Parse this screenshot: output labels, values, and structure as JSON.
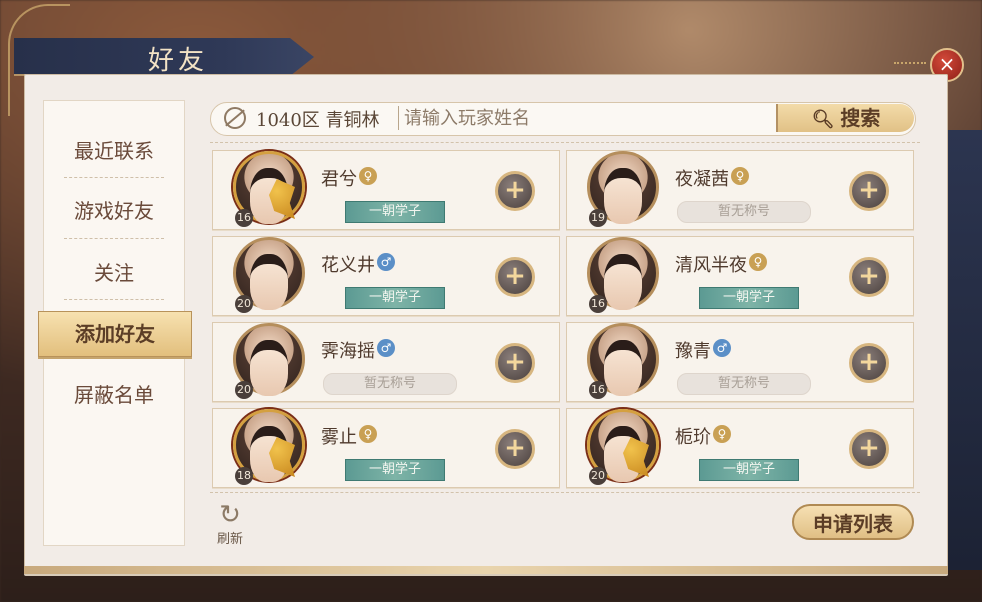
{
  "header": {
    "title": "好友",
    "close_icon": "×"
  },
  "nav": {
    "items": [
      {
        "label": "最近联系",
        "active": false
      },
      {
        "label": "游戏好友",
        "active": false
      },
      {
        "label": "关注",
        "active": false
      },
      {
        "label": "添加好友",
        "active": true
      },
      {
        "label": "屏蔽名单",
        "active": false
      }
    ]
  },
  "search": {
    "server": "1040区 青铜林",
    "placeholder": "请输入玩家姓名",
    "button_label": "搜索",
    "button_icon": "search-icon"
  },
  "players": [
    {
      "name": "君兮",
      "gender": "female",
      "gender_symbol": "♀",
      "level": "16",
      "title": "一朝学子",
      "has_title": true,
      "frame": "gold"
    },
    {
      "name": "夜凝茜",
      "gender": "female",
      "gender_symbol": "♀",
      "level": "19",
      "title": "暂无称号",
      "has_title": false,
      "frame": "plain"
    },
    {
      "name": "花义井",
      "gender": "male",
      "gender_symbol": "♂",
      "level": "20",
      "title": "一朝学子",
      "has_title": true,
      "frame": "plain"
    },
    {
      "name": "清风半夜",
      "gender": "female",
      "gender_symbol": "♀",
      "level": "16",
      "title": "一朝学子",
      "has_title": true,
      "frame": "plain"
    },
    {
      "name": "霁海摇",
      "gender": "male",
      "gender_symbol": "♂",
      "level": "20",
      "title": "暂无称号",
      "has_title": false,
      "frame": "plain"
    },
    {
      "name": "豫青",
      "gender": "male",
      "gender_symbol": "♂",
      "level": "16",
      "title": "暂无称号",
      "has_title": false,
      "frame": "plain"
    },
    {
      "name": "雾止",
      "gender": "female",
      "gender_symbol": "♀",
      "level": "18",
      "title": "一朝学子",
      "has_title": true,
      "frame": "gold"
    },
    {
      "name": "栀玠",
      "gender": "female",
      "gender_symbol": "♀",
      "level": "20",
      "title": "一朝学子",
      "has_title": true,
      "frame": "gold"
    }
  ],
  "footer": {
    "refresh_label": "刷新",
    "refresh_icon": "refresh-icon",
    "request_list_label": "申请列表"
  },
  "colors": {
    "accent_gold": "#e0bf85",
    "title_teal": "#6aa69c",
    "female": "#c9a054",
    "male": "#5b8fc7"
  }
}
